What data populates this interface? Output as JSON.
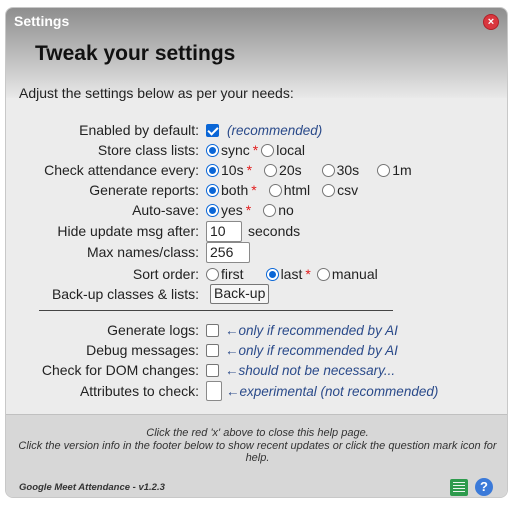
{
  "dialog": {
    "title": "Settings",
    "close_symbol": "×",
    "heading": "Tweak your settings",
    "intro": "Adjust the settings below as per your needs:"
  },
  "settings": {
    "enabled_default": {
      "label": "Enabled by default:",
      "checked": true,
      "note": "(recommended)"
    },
    "store_class_lists": {
      "label": "Store class lists:",
      "options": [
        "sync",
        "local"
      ],
      "selected": "sync",
      "recommended": "sync"
    },
    "check_attendance": {
      "label": "Check attendance every:",
      "options": [
        "10s",
        "20s",
        "30s",
        "1m"
      ],
      "selected": "10s",
      "recommended": "10s"
    },
    "generate_reports": {
      "label": "Generate reports:",
      "options": [
        "both",
        "html",
        "csv"
      ],
      "selected": "both",
      "recommended": "both"
    },
    "auto_save": {
      "label": "Auto-save:",
      "options": [
        "yes",
        "no"
      ],
      "selected": "yes",
      "recommended": "yes"
    },
    "hide_update": {
      "label": "Hide update msg after:",
      "value": "10",
      "unit": "seconds"
    },
    "max_names": {
      "label": "Max names/class:",
      "value": "256"
    },
    "sort_order": {
      "label": "Sort order:",
      "options": [
        "first",
        "last",
        "manual"
      ],
      "selected": "last",
      "recommended": "last"
    },
    "backup": {
      "label": "Back-up classes & lists:",
      "button": "Back-up"
    }
  },
  "advanced": {
    "generate_logs": {
      "label": "Generate logs:",
      "checked": false,
      "note": "←only if recommended by AI"
    },
    "debug_messages": {
      "label": "Debug messages:",
      "checked": false,
      "note": "←only if recommended by AI"
    },
    "dom_changes": {
      "label": "Check for DOM changes:",
      "checked": false,
      "note": "←should not be necessary..."
    },
    "attributes": {
      "label": "Attributes to check:",
      "value": "",
      "note": "←experimental (not recommended)"
    }
  },
  "star": "*",
  "help": {
    "line1": "Click the red 'x' above to close this help page.",
    "line2": "Click the version info in the footer below to show recent updates or click the question mark icon for help."
  },
  "footer": {
    "version": "Google Meet Attendance - v1.2.3",
    "help_symbol": "?"
  },
  "colors": {
    "accent": "#0a66d6",
    "star": "#e21b1b",
    "note": "#2a4a8a",
    "close": "#d9363e"
  }
}
